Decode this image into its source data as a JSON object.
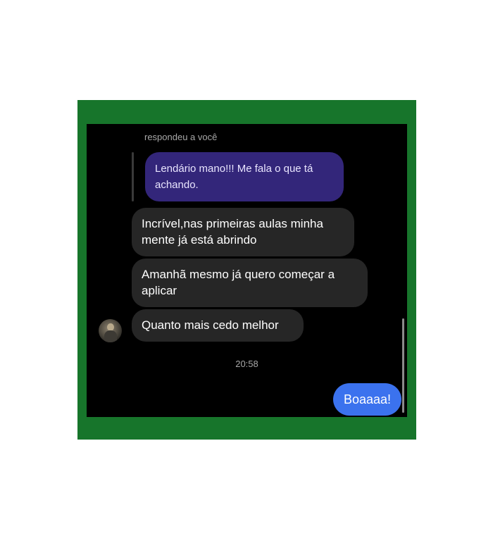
{
  "reply": {
    "header": "respondeu a você",
    "quoted_text": "Lendário mano!!! Me fala o que tá achando."
  },
  "messages": {
    "incoming": [
      "Incrível,nas primeiras aulas minha mente já está abrindo",
      "Amanhã mesmo já quero começar a aplicar",
      "Quanto mais cedo melhor"
    ],
    "timestamp": "20:58",
    "outgoing": "Boaaaa!"
  },
  "colors": {
    "frame": "#17752b",
    "background": "#000000",
    "quoted_bubble": "#33267a",
    "incoming_bubble": "#262626",
    "outgoing_bubble": "#3b72ee"
  },
  "icons": {
    "avatar": "user-avatar-photo"
  }
}
